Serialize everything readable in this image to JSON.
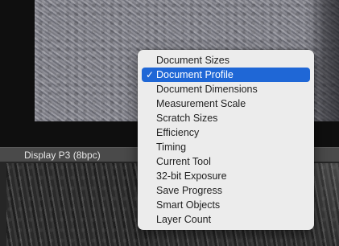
{
  "status_bar": {
    "label": "Display P3 (8bpc)"
  },
  "menu": {
    "items": [
      {
        "label": "Document Sizes",
        "selected": false
      },
      {
        "label": "Document Profile",
        "selected": true
      },
      {
        "label": "Document Dimensions",
        "selected": false
      },
      {
        "label": "Measurement Scale",
        "selected": false
      },
      {
        "label": "Scratch Sizes",
        "selected": false
      },
      {
        "label": "Efficiency",
        "selected": false
      },
      {
        "label": "Timing",
        "selected": false
      },
      {
        "label": "Current Tool",
        "selected": false
      },
      {
        "label": "32-bit Exposure",
        "selected": false
      },
      {
        "label": "Save Progress",
        "selected": false
      },
      {
        "label": "Smart Objects",
        "selected": false
      },
      {
        "label": "Layer Count",
        "selected": false
      }
    ],
    "check_glyph": "✓",
    "highlight_color": "#1f67d6"
  }
}
